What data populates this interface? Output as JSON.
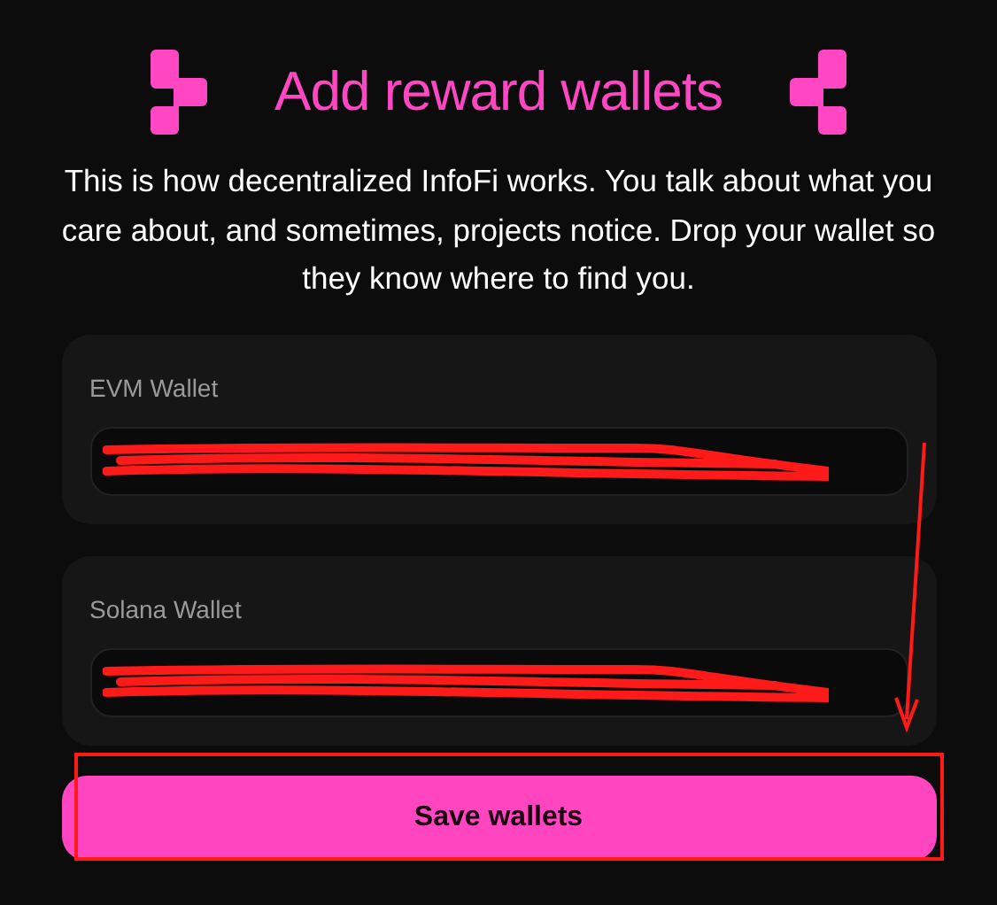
{
  "title": "Add reward wallets",
  "description": "This is how decentralized InfoFi works. You talk about what you care about, and sometimes, projects notice. Drop your wallet so they know where to find you.",
  "wallets": [
    {
      "label": "EVM Wallet",
      "redacted": true
    },
    {
      "label": "Solana Wallet",
      "redacted": true
    }
  ],
  "save_button": "Save wallets"
}
